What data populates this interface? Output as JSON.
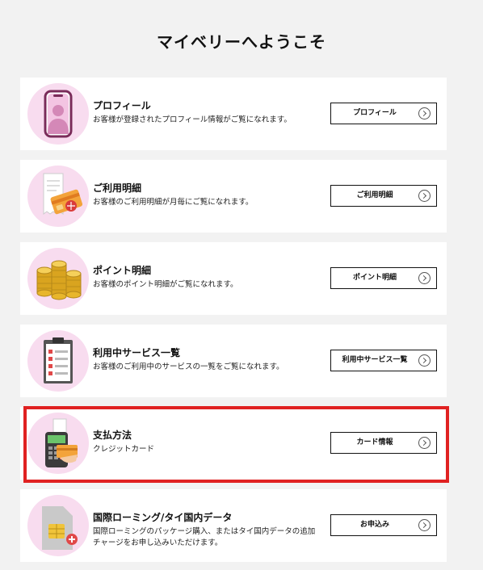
{
  "page": {
    "title": "マイベリーへようこそ"
  },
  "cards": [
    {
      "icon": "profile-icon",
      "title": "プロフィール",
      "desc": "お客様が登録されたプロフィール情報がご覧になれます。",
      "button": "プロフィール"
    },
    {
      "icon": "billing-statement-icon",
      "title": "ご利用明細",
      "desc": "お客様のご利用明細が月毎にご覧になれます。",
      "button": "ご利用明細"
    },
    {
      "icon": "coins-icon",
      "title": "ポイント明細",
      "desc": "お客様のポイント明細がご覧になれます。",
      "button": "ポイント明細"
    },
    {
      "icon": "clipboard-checklist-icon",
      "title": "利用中サービス一覧",
      "desc": "お客様のご利用中のサービスの一覧をご覧になれます。",
      "button": "利用中サービス一覧"
    },
    {
      "icon": "card-terminal-icon",
      "title": "支払方法",
      "desc": "クレジットカード",
      "button": "カード情報"
    },
    {
      "icon": "sim-card-icon",
      "title": "国際ローミング/タイ国内データ",
      "desc": "国際ローミングのパッケージ購入、またはタイ国内データの追加",
      "desc2": "チャージをお申し込みいただけます。",
      "button": "お申込み"
    }
  ],
  "colors": {
    "icon_bg": "#f8dcef",
    "highlight": "#e02121",
    "page_bg": "#f2f2f2"
  }
}
